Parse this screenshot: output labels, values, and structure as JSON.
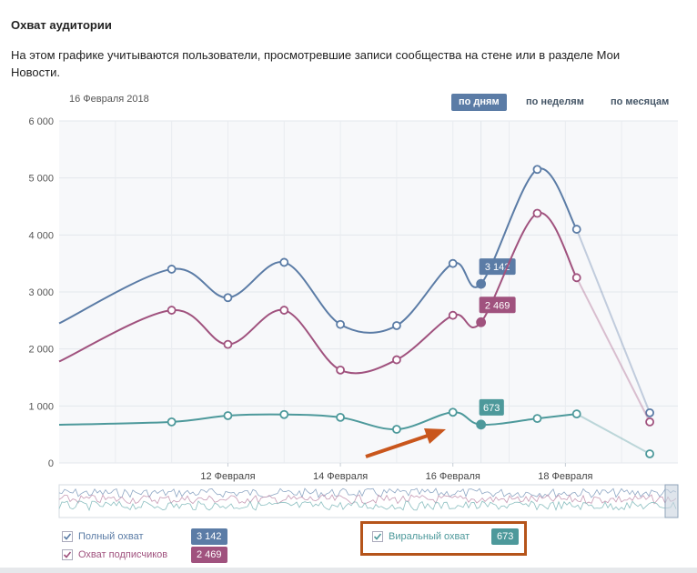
{
  "header": {
    "title": "Охват аудитории",
    "description": "На этом графике учитываются пользователи, просмотревшие записи сообщества на стене или в разделе Мои Новости."
  },
  "toolbar": {
    "current_date": "16 Февраля 2018",
    "periods": [
      "по дням",
      "по неделям",
      "по месяцам"
    ],
    "active_period": "по дням"
  },
  "legend": {
    "full": {
      "label": "Полный охват",
      "value": "3 142",
      "checked": true,
      "color": "#5b7ca6"
    },
    "subscribers": {
      "label": "Охват подписчиков",
      "value": "2 469",
      "checked": true,
      "color": "#a0527e"
    },
    "viral": {
      "label": "Виральный охват",
      "value": "673",
      "checked": true,
      "color": "#4d999b"
    }
  },
  "chart_data": {
    "type": "line",
    "x": [
      10.0,
      11.0,
      12.0,
      13.0,
      14.0,
      15.0,
      16.0,
      16.5,
      17.5,
      18.2,
      19.5
    ],
    "xticks": [
      "12 Февраля",
      "14 Февраля",
      "16 Февраля",
      "18 Февраля"
    ],
    "xtick_values": [
      12,
      14,
      16,
      18
    ],
    "yticks": [
      "0",
      "1 000",
      "2 000",
      "3 000",
      "4 000",
      "5 000",
      "6 000"
    ],
    "ylim": [
      0,
      6000
    ],
    "grid": true,
    "series": [
      {
        "name": "Полный охват",
        "color": "#5b7ca6",
        "start": 2450,
        "values": [
          3400,
          2900,
          3520,
          2430,
          2410,
          3500,
          3142,
          5150,
          4100,
          880
        ]
      },
      {
        "name": "Охват подписчиков",
        "color": "#a0527e",
        "start": 1780,
        "values": [
          2680,
          2080,
          2680,
          1630,
          1810,
          2590,
          2469,
          4380,
          3250,
          720
        ]
      },
      {
        "name": "Виральный охват",
        "color": "#4d999b",
        "start": 670,
        "values": [
          720,
          830,
          850,
          800,
          590,
          890,
          673,
          780,
          860,
          160
        ]
      }
    ],
    "highlight_date": 16.5,
    "tooltips": [
      "3 142",
      "2 469",
      "673"
    ]
  }
}
